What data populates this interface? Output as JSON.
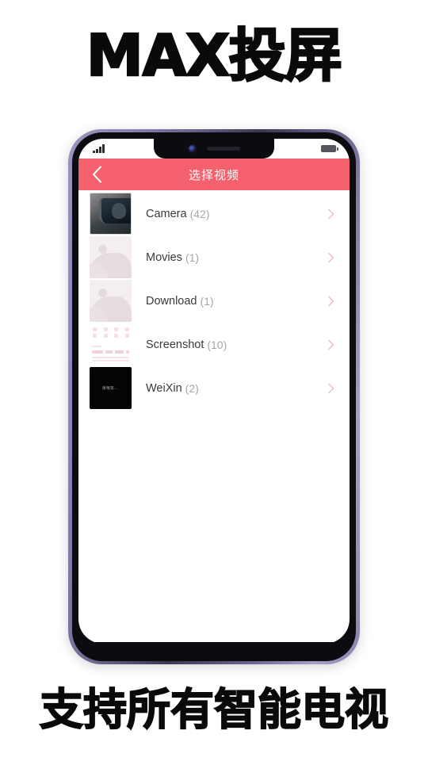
{
  "promo": {
    "top_text": "MAX投屏",
    "bottom_text": "支持所有智能电视"
  },
  "phone": {
    "statusbar": {
      "signal_icon": "signal-bars-icon",
      "battery_icon": "battery-icon"
    },
    "notch": {
      "camera_icon": "front-camera-icon",
      "speaker_icon": "earpiece-speaker-icon"
    }
  },
  "app": {
    "header": {
      "back_icon": "chevron-left-icon",
      "title": "选择视频"
    },
    "folders": [
      {
        "name": "Camera",
        "count": "(42)",
        "thumb_type": "photo",
        "thumb_name": "camera-folder-thumbnail",
        "chevron_icon": "chevron-right-icon"
      },
      {
        "name": "Movies",
        "count": "(1)",
        "thumb_type": "placeholder",
        "thumb_name": "movies-folder-thumbnail",
        "chevron_icon": "chevron-right-icon"
      },
      {
        "name": "Download",
        "count": "(1)",
        "thumb_type": "placeholder",
        "thumb_name": "download-folder-thumbnail",
        "chevron_icon": "chevron-right-icon"
      },
      {
        "name": "Screenshot",
        "count": "(10)",
        "thumb_type": "screenshot",
        "thumb_name": "screenshot-folder-thumbnail",
        "chevron_icon": "chevron-right-icon"
      },
      {
        "name": "WeiXin",
        "count": "(2)",
        "thumb_type": "black",
        "thumb_text": "请稍等…",
        "thumb_name": "weixin-folder-thumbnail",
        "chevron_icon": "chevron-right-icon"
      }
    ]
  },
  "colors": {
    "header_bg": "#f4606c",
    "chevron": "#f0bcc2",
    "frame_purple": "#8d84b3",
    "bezel_black": "#0b0b10"
  }
}
